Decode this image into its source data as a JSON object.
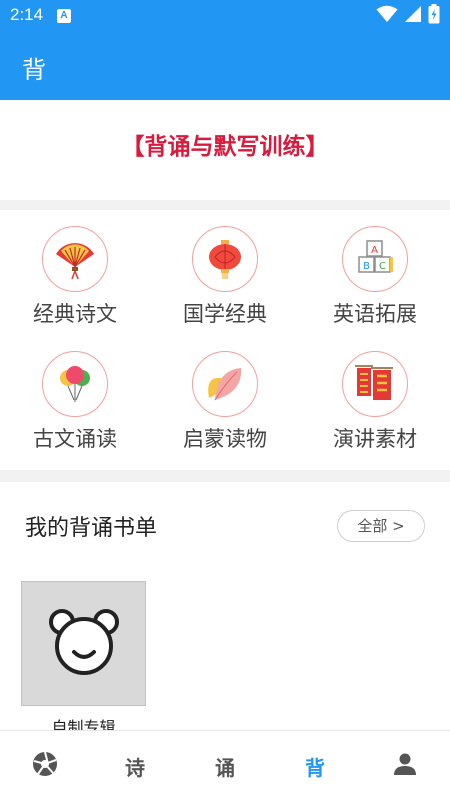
{
  "status_bar": {
    "time": "2:14",
    "notification_badge": "A"
  },
  "app_bar": {
    "title": "背"
  },
  "banner": {
    "text": "【背诵与默写训练】"
  },
  "categories": [
    {
      "label": "经典诗文",
      "icon": "fan-icon"
    },
    {
      "label": "国学经典",
      "icon": "lantern-icon"
    },
    {
      "label": "英语拓展",
      "icon": "abc-blocks-icon"
    },
    {
      "label": "古文诵读",
      "icon": "balloons-icon"
    },
    {
      "label": "启蒙读物",
      "icon": "leaf-icon"
    },
    {
      "label": "演讲素材",
      "icon": "couplet-icon"
    }
  ],
  "booklist": {
    "title": "我的背诵书单",
    "all_button": "全部 >",
    "albums": [
      {
        "label": "自制专辑",
        "icon": "bear-face-icon"
      }
    ]
  },
  "bottom_nav": {
    "items": [
      {
        "label": "",
        "icon": "aperture-icon"
      },
      {
        "label": "诗"
      },
      {
        "label": "诵"
      },
      {
        "label": "背",
        "active": true
      },
      {
        "label": "",
        "icon": "person-icon"
      }
    ]
  },
  "colors": {
    "primary": "#2196f3",
    "banner_red": "#d81b3c",
    "icon_border": "#f2a0a0"
  }
}
